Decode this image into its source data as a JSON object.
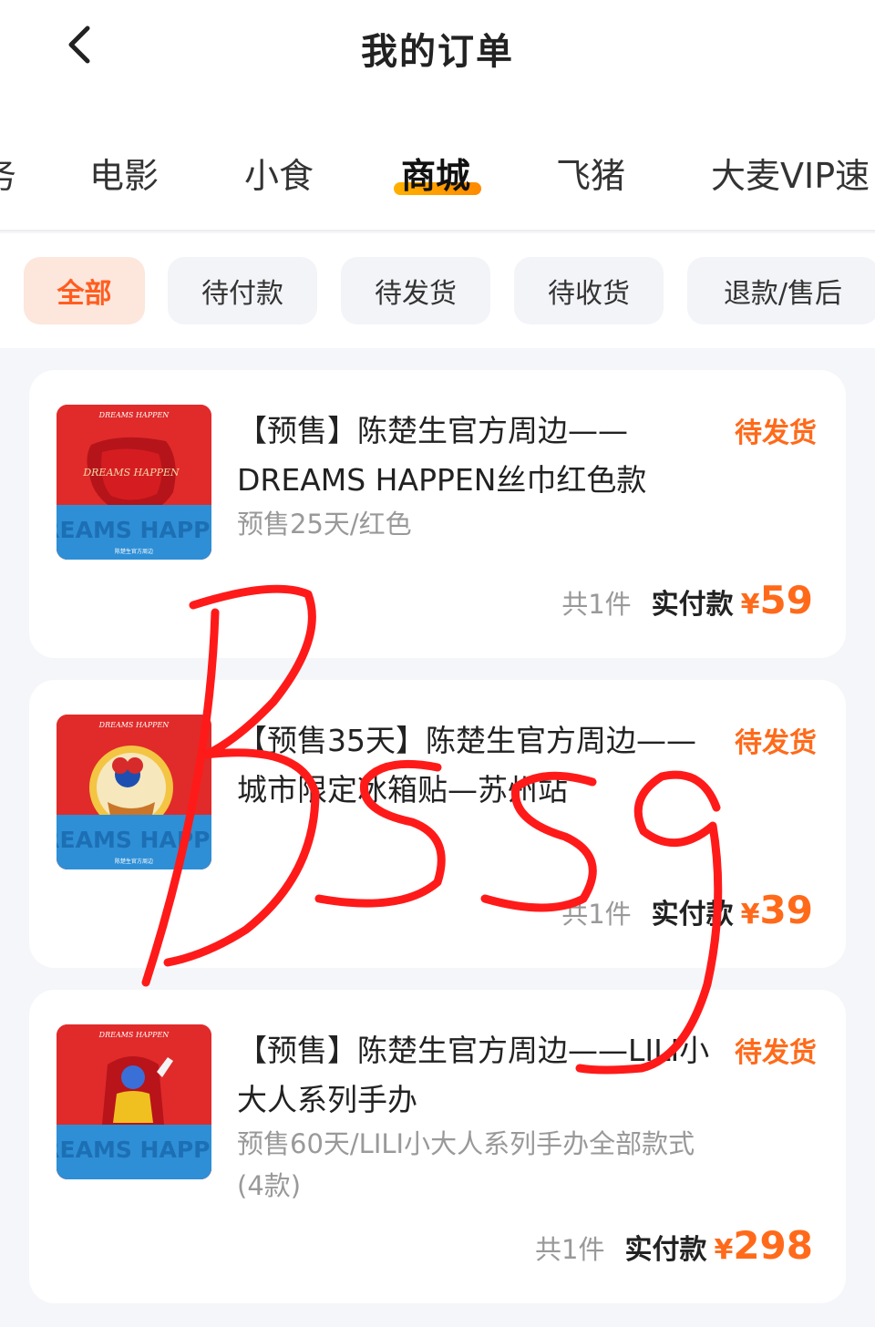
{
  "header": {
    "title": "我的订单"
  },
  "tabs": [
    {
      "label": "务",
      "active": false
    },
    {
      "label": "电影",
      "active": false
    },
    {
      "label": "小食",
      "active": false
    },
    {
      "label": "商城",
      "active": true
    },
    {
      "label": "飞猪",
      "active": false
    },
    {
      "label": "大麦VIP速",
      "active": false
    }
  ],
  "filters": [
    {
      "label": "全部",
      "active": true
    },
    {
      "label": "待付款",
      "active": false
    },
    {
      "label": "待发货",
      "active": false
    },
    {
      "label": "待收货",
      "active": false
    },
    {
      "label": "退款/售后",
      "active": false
    }
  ],
  "orders": [
    {
      "title": "【预售】陈楚生官方周边——DREAMS HAPPEN丝巾红色款",
      "status": "待发货",
      "spec": "预售25天/红色",
      "quantity": "共1件",
      "paid_label": "实付款",
      "currency": "¥",
      "amount": "59",
      "thumb_brand": "DREAMS HAPPEN",
      "thumb_logo": "DREAMS HAPPEN",
      "thumb_caption": "陈楚生官方周边"
    },
    {
      "title": "【预售35天】陈楚生官方周边——城市限定冰箱贴—苏州站",
      "status": "待发货",
      "spec": "",
      "quantity": "共1件",
      "paid_label": "实付款",
      "currency": "¥",
      "amount": "39",
      "thumb_brand": "DREAMS HAPPEN",
      "thumb_caption": "陈楚生官方周边"
    },
    {
      "title": "【预售】陈楚生官方周边——LILI小大人系列手办",
      "status": "待发货",
      "spec": "预售60天/LILI小大人系列手办全部款式(4款)",
      "quantity": "共1件",
      "paid_label": "实付款",
      "currency": "¥",
      "amount": "298",
      "thumb_brand": "DREAMS HAPPEN"
    }
  ],
  "colors": {
    "accent": "#ff6a1a",
    "tab_indicator": "#ff9a00",
    "chip_active_bg": "#fde6dc",
    "thumb_red": "#e02b2a",
    "thumb_blue": "#2e8fd6"
  }
}
